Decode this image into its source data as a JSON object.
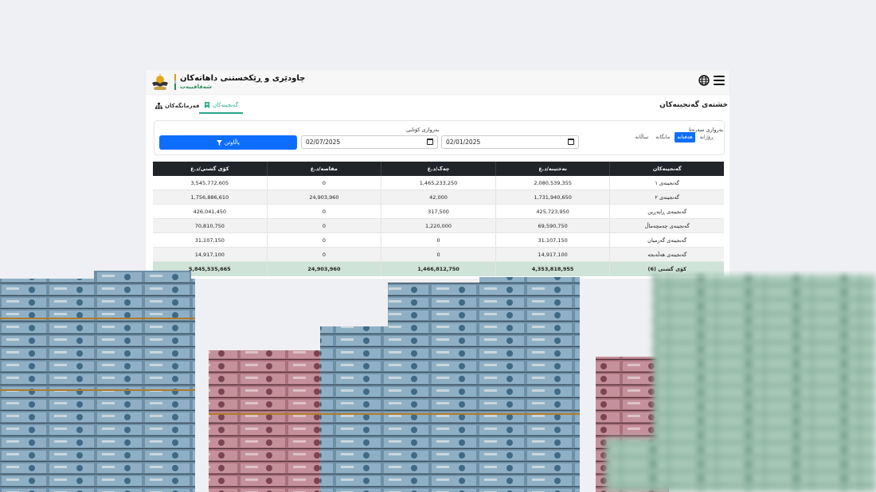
{
  "header": {
    "title": "چاودێری و ڕێکخستنی داهاتەکان",
    "subtitle": "شەفافییەت"
  },
  "page": {
    "title": "خشتەی گەنجینەکان"
  },
  "tabs": [
    {
      "label": "گەنجینەکان",
      "icon": "treasury-icon",
      "active": true
    },
    {
      "label": "فەرمانگەکان",
      "icon": "org-chart-icon",
      "active": false
    }
  ],
  "filter": {
    "periods": [
      "ڕۆژانە",
      "هەفتانە",
      "مانگانە",
      "ساڵانە"
    ],
    "selected_period": "هەفتانە",
    "start_label": "بەرواری سەرەتا",
    "start_value": "02/01/2025",
    "end_label": "بەرواری کۆتایی",
    "end_value": "02/07/2025",
    "button_label": "پاڵاوتن"
  },
  "table": {
    "columns": [
      "گەنجینەکان",
      "نەختینە/د.ع",
      "چەک/د.ع",
      "مقاصە/د.ع",
      "کۆی گشتی/د.ع"
    ],
    "rows": [
      [
        "گەنجینەی ١",
        "2,080,539,355",
        "1,465,233,250",
        "0",
        "3,545,772,605"
      ],
      [
        "گەنجینەی ٢",
        "1,731,940,650",
        "42,000",
        "24,903,960",
        "1,756,886,610"
      ],
      [
        "گەنجینەی ڕاپەڕین",
        "425,723,950",
        "317,500",
        "0",
        "426,041,450"
      ],
      [
        "گەنجینەی چەمچەماڵ",
        "69,590,750",
        "1,220,000",
        "0",
        "70,810,750"
      ],
      [
        "گەنجینەی گەرمیان",
        "31,107,150",
        "0",
        "0",
        "31,107,150"
      ],
      [
        "گەنجینەی هەڵەبجە",
        "14,917,100",
        "0",
        "0",
        "14,917,100"
      ]
    ],
    "total": [
      "کۆی گشتی (6)",
      "4,353,818,955",
      "1,466,812,750",
      "24,903,960",
      "5,845,535,665"
    ]
  },
  "colors": {
    "accent": "#0d6efd",
    "tab_active": "#2aa68a",
    "table_header": "#212529",
    "total_row": "#cfe3d8"
  }
}
